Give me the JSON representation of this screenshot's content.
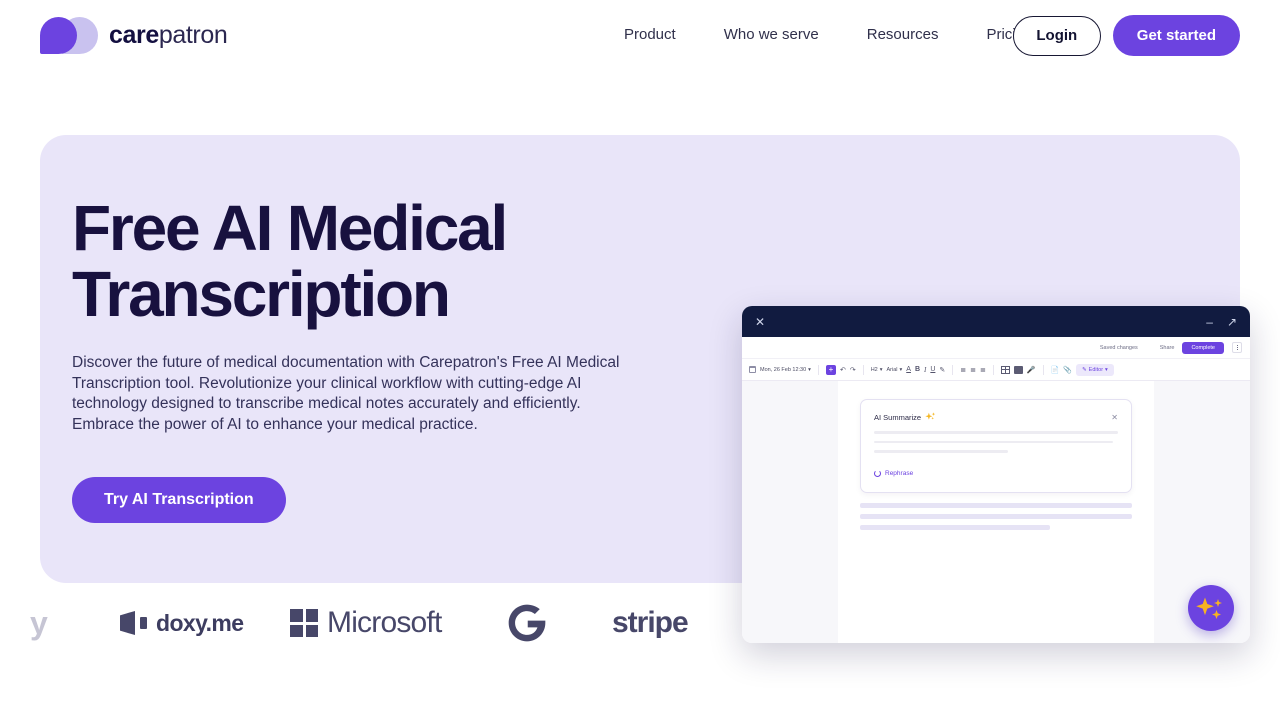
{
  "brand": {
    "name_bold": "care",
    "name_light": "patron",
    "logo_icon": "carepatron-blobs-logo",
    "colors": {
      "primary": "#6c43e0",
      "secondary": "#c9c2ef"
    }
  },
  "header": {
    "nav": [
      {
        "label": "Product",
        "name": "nav-product"
      },
      {
        "label": "Who we serve",
        "name": "nav-who-we-serve"
      },
      {
        "label": "Resources",
        "name": "nav-resources"
      },
      {
        "label": "Pricing",
        "name": "nav-pricing"
      }
    ],
    "login_label": "Login",
    "get_started_label": "Get started"
  },
  "hero": {
    "title": "Free AI Medical\nTranscription",
    "subtitle": "Discover the future of medical documentation with Carepatron's Free AI Medical Transcription tool. Revolutionize your clinical workflow with cutting-edge AI technology designed to transcribe medical notes accurately and efficiently. Embrace the power of AI to enhance your medical practice.",
    "cta_label": "Try AI Transcription",
    "background_color": "#e9e5f9",
    "title_color": "#18113f"
  },
  "app_mockup": {
    "titlebar": {
      "close_icon": "close-icon",
      "minimize_icon": "minimize-icon",
      "expand_icon": "expand-icon"
    },
    "topbar": {
      "saved_label": "Saved changes",
      "share_label": "Share",
      "complete_label": "Complete",
      "menu_icon": "kebab-menu-icon"
    },
    "toolbar": {
      "date_label": "Mon, 26 Feb 12:30",
      "date_caret": "▾",
      "add_label": "+",
      "undo_icon": "undo-icon",
      "redo_icon": "redo-icon",
      "heading_label": "H2",
      "font_label": "Arial",
      "caret": "▾",
      "text_color_label": "A",
      "bold_label": "B",
      "italic_label": "I",
      "underline_label": "U",
      "highlight_icon": "highlighter-icon",
      "bullet_icon": "bullet-list-icon",
      "numbered_icon": "numbered-list-icon",
      "align_icon": "align-icon",
      "table_icon": "table-icon",
      "image_icon": "image-icon",
      "mic_icon": "microphone-icon",
      "file_icon": "file-icon",
      "attach_icon": "paperclip-icon",
      "editor_label": "Editor",
      "editor_pencil_icon": "pencil-icon"
    },
    "ai_card": {
      "title": "AI Summarize",
      "sparkle_icon": "sparkles-icon",
      "close_icon": "close-icon",
      "rephrase_label": "Rephrase",
      "refresh_icon": "refresh-icon"
    },
    "fab": {
      "icon": "ai-sparkles-icon",
      "color": "#6c43e0"
    }
  },
  "logo_strip": {
    "partial_text": "y",
    "logos": [
      {
        "name": "doxy-me-logo",
        "label": "doxy.me"
      },
      {
        "name": "microsoft-logo",
        "label": "Microsoft"
      },
      {
        "name": "google-logo",
        "label": "G"
      },
      {
        "name": "stripe-logo",
        "label": "stripe"
      }
    ]
  }
}
